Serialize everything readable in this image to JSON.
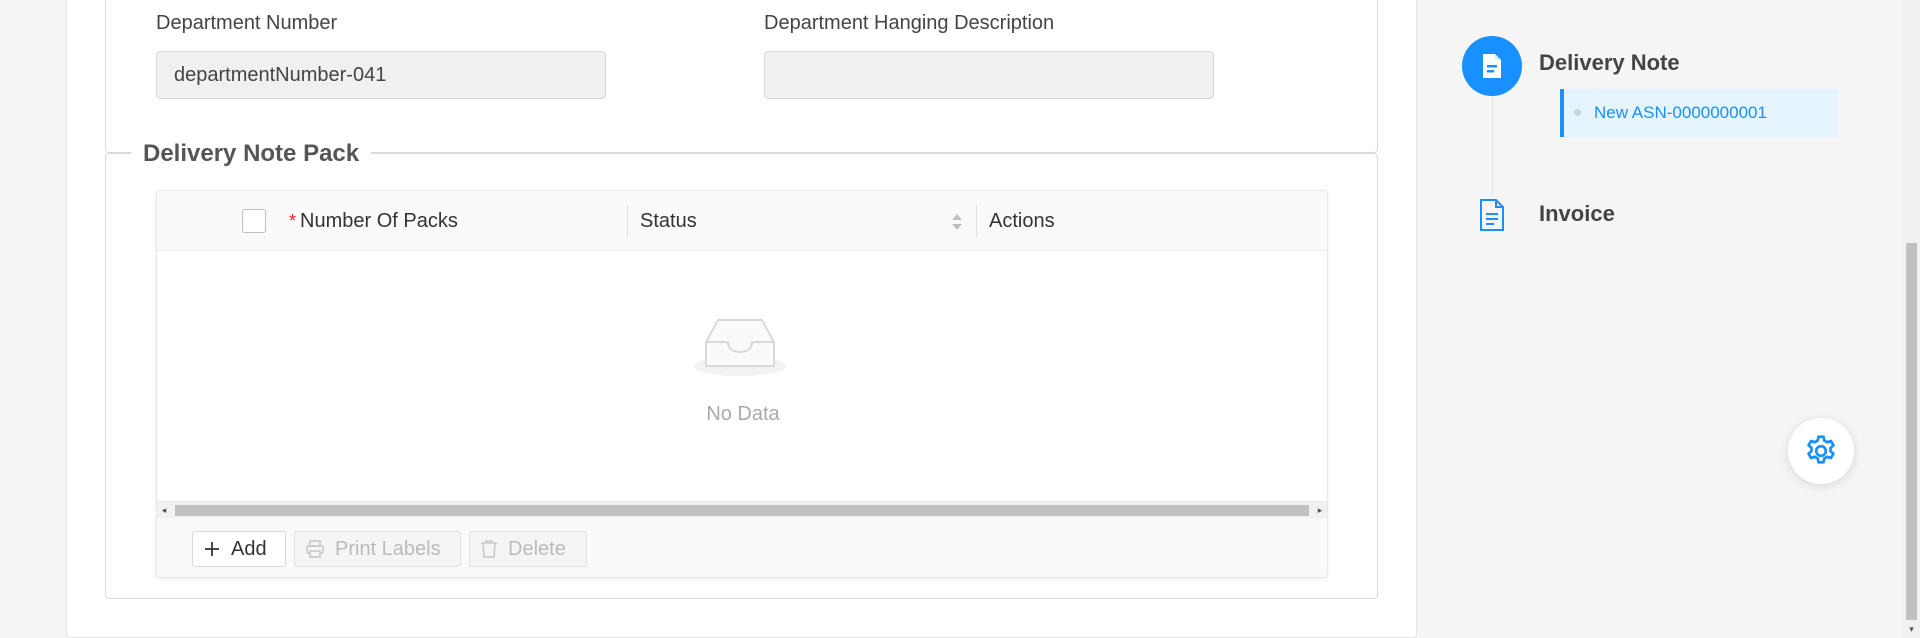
{
  "form": {
    "department_number_label": "Department Number",
    "department_number_value": "departmentNumber-041",
    "hanging_description_label": "Department Hanging Description",
    "hanging_description_value": ""
  },
  "pack_section": {
    "legend": "Delivery Note Pack",
    "columns": {
      "required_mark": "*",
      "number_of_packs": "Number Of Packs",
      "status": "Status",
      "actions": "Actions"
    },
    "empty_text": "No Data",
    "buttons": {
      "add": "Add",
      "print_labels": "Print Labels",
      "delete": "Delete"
    },
    "buttons_disabled": [
      "print_labels",
      "delete"
    ]
  },
  "steps": {
    "delivery_note": {
      "title": "Delivery Note",
      "sub_item": "New  ASN-0000000001",
      "icon": "document-icon",
      "active": true
    },
    "invoice": {
      "title": "Invoice",
      "icon": "invoice-icon",
      "active": false
    }
  },
  "settings_fab": {
    "icon": "gear-icon"
  },
  "colors": {
    "accent": "#1890ff",
    "required": "#f5222d",
    "sub_item_bg": "#e6f4ff"
  }
}
